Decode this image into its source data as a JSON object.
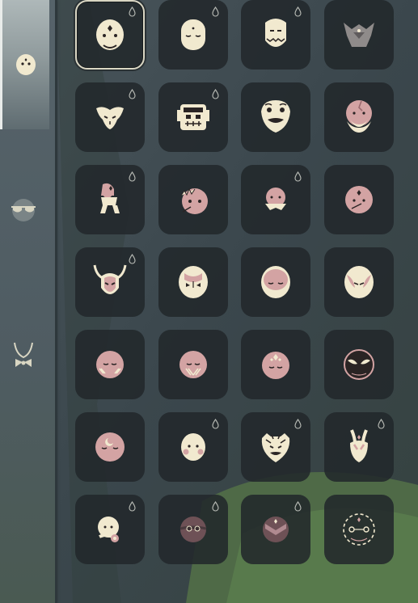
{
  "colors": {
    "background": "#3e4a50",
    "sidebar": "#55626a",
    "tile": "#22282b",
    "cream": "#f1e9cf",
    "pink": "#d3a3a3",
    "dark_pink": "#9a6a6e",
    "ink": "#2a2424"
  },
  "sidebar": {
    "tabs": [
      {
        "name": "masks",
        "icon": "mask-icon",
        "active": true
      },
      {
        "name": "eyewear",
        "icon": "sunglasses-icon",
        "active": false
      },
      {
        "name": "neckwear",
        "icon": "bowtie-icon",
        "active": false
      }
    ]
  },
  "grid": {
    "columns": 4,
    "rows": 7,
    "selected_index": 0,
    "items": [
      {
        "icon": "round-cream-mask-icon",
        "dyeable": true
      },
      {
        "icon": "sleepy-cream-mask-icon",
        "dyeable": true
      },
      {
        "icon": "toothed-cream-mask-icon",
        "dyeable": true
      },
      {
        "icon": "horned-demon-mask-icon",
        "dyeable": false
      },
      {
        "icon": "winged-bone-mask-icon",
        "dyeable": true
      },
      {
        "icon": "tribal-totem-mask-icon",
        "dyeable": true
      },
      {
        "icon": "lion-dance-mask-icon",
        "dyeable": false
      },
      {
        "icon": "bearded-cracked-mask-icon",
        "dyeable": false
      },
      {
        "icon": "gnome-figure-mask-icon",
        "dyeable": true
      },
      {
        "icon": "spiked-pink-mask-icon",
        "dyeable": false
      },
      {
        "icon": "bandana-pink-mask-icon",
        "dyeable": true
      },
      {
        "icon": "scarred-pink-mask-icon",
        "dyeable": false
      },
      {
        "icon": "antlered-helmet-mask-icon",
        "dyeable": true
      },
      {
        "icon": "owl-cream-mask-icon",
        "dyeable": false
      },
      {
        "icon": "hooded-pink-mask-icon",
        "dyeable": false
      },
      {
        "icon": "fox-cream-mask-icon",
        "dyeable": false
      },
      {
        "icon": "whiskered-pink-mask-icon",
        "dyeable": false
      },
      {
        "icon": "painted-pink-mask-icon",
        "dyeable": false
      },
      {
        "icon": "forehead-gem-mask-icon",
        "dyeable": false
      },
      {
        "icon": "dark-angry-mask-icon",
        "dyeable": false
      },
      {
        "icon": "moon-pink-mask-icon",
        "dyeable": false
      },
      {
        "icon": "blush-cream-mask-icon",
        "dyeable": true
      },
      {
        "icon": "tiger-mask-icon",
        "dyeable": true
      },
      {
        "icon": "rabbit-mask-icon",
        "dyeable": true
      },
      {
        "icon": "flower-cream-mask-icon",
        "dyeable": true
      },
      {
        "icon": "goggle-dark-mask-icon",
        "dyeable": true
      },
      {
        "icon": "shaded-dark-mask-icon",
        "dyeable": true
      },
      {
        "icon": "dashed-outline-mask-icon",
        "dyeable": false
      }
    ]
  }
}
